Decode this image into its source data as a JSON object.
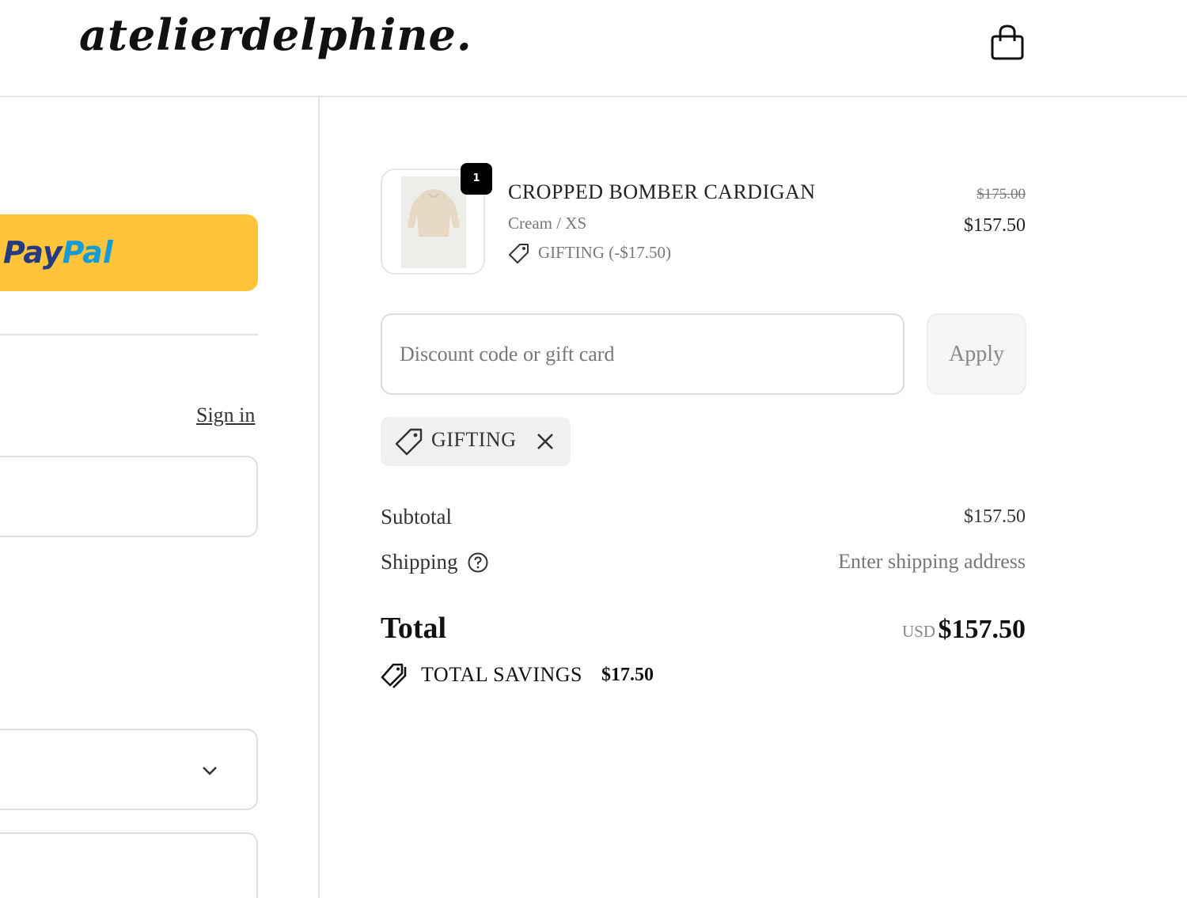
{
  "header": {
    "logo": "atelierdelphine.",
    "cart_icon": "shopping-bag-icon"
  },
  "express_checkout": {
    "paypal_pay": "Pay",
    "paypal_pal": "Pal"
  },
  "contact": {
    "sign_in": "Sign in"
  },
  "cart": {
    "item": {
      "quantity": "1",
      "name": "CROPPED BOMBER CARDIGAN",
      "variant": "Cream / XS",
      "discount": "GIFTING (-$17.50)",
      "original_price": "$175.00",
      "price": "$157.50"
    }
  },
  "discount": {
    "placeholder": "Discount code or gift card",
    "apply_label": "Apply",
    "applied_code": "GIFTING"
  },
  "summary": {
    "subtotal_label": "Subtotal",
    "subtotal_value": "$157.50",
    "shipping_label": "Shipping",
    "shipping_value": "Enter shipping address",
    "total_label": "Total",
    "currency": "USD",
    "total_value": "$157.50",
    "savings_label": "TOTAL SAVINGS",
    "savings_value": "$17.50"
  },
  "colors": {
    "paypal_yellow": "#ffc43a",
    "paypal_dark_blue": "#253b80",
    "paypal_light_blue": "#179bd7",
    "border": "#dedede"
  }
}
